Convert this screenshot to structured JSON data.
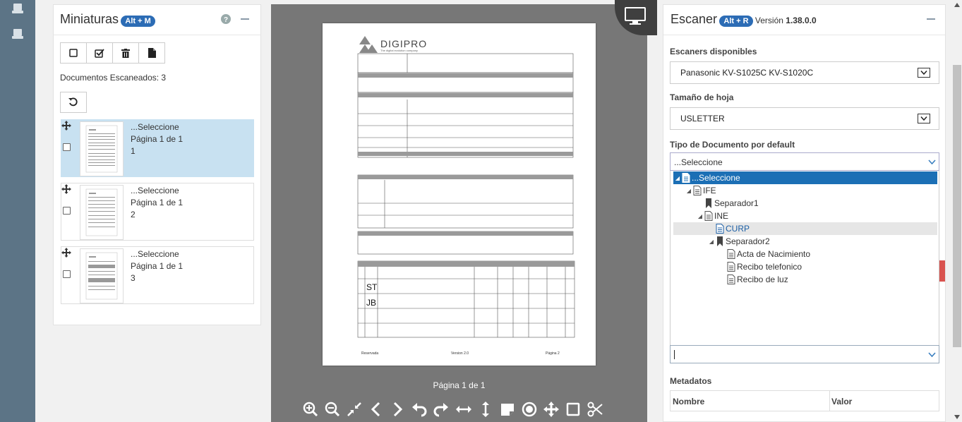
{
  "thumbnails": {
    "title": "Miniaturas",
    "shortcut": "Alt + M",
    "help_icon": "question-circle-icon",
    "collapse_icon": "minus-icon",
    "toolbar": [
      "square-icon",
      "check-square-icon",
      "trash-icon",
      "file-icon"
    ],
    "count_label": "Documentos Escaneados: 3",
    "refresh_icon": "undo-icon",
    "items": [
      {
        "type": "...Seleccione",
        "page": "Página 1 de 1",
        "number": "1",
        "selected": true
      },
      {
        "type": "...Seleccione",
        "page": "Página 1 de 1",
        "number": "2",
        "selected": false
      },
      {
        "type": "...Seleccione",
        "page": "Página 1 de 1",
        "number": "3",
        "selected": false
      }
    ]
  },
  "viewer": {
    "page_label": "Página 1 de 1",
    "monitor_icon": "monitor-icon",
    "tools": [
      "zoom-in-icon",
      "zoom-out-icon",
      "compress-icon",
      "chevron-left-icon",
      "chevron-right-icon",
      "rotate-left-icon",
      "rotate-right-icon",
      "flip-horizontal-icon",
      "flip-vertical-icon",
      "sticky-note-icon",
      "target-icon",
      "move-icon",
      "crop-square-icon",
      "scissors-icon"
    ],
    "document": {
      "logo": "DIGIPRO",
      "tagline": "The digital evolution company",
      "footer_left": "Reservada",
      "footer_center": "Version 2.0",
      "footer_right": "Página 2",
      "row_initials": [
        "ST",
        "JB"
      ]
    }
  },
  "scanner": {
    "title": "Escaner",
    "shortcut": "Alt + R",
    "version_prefix": "Versión",
    "version": "1.38.0.0",
    "collapse_icon": "minus-icon",
    "available_label": "Escaners disponibles",
    "available_value": "Panasonic KV-S1025C KV-S1020C",
    "size_label": "Tamaño de hoja",
    "size_value": "USLETTER",
    "doc_type_label": "Tipo de Documento por default",
    "doc_type_value": "...Seleccione",
    "tree": [
      {
        "label": "...Seleccione",
        "level": 0,
        "kind": "doc",
        "expanded": true,
        "selected": true
      },
      {
        "label": "IFE",
        "level": 1,
        "kind": "doc",
        "expanded": true
      },
      {
        "label": "Separador1",
        "level": 2,
        "kind": "bookmark"
      },
      {
        "label": "INE",
        "level": 2,
        "kind": "doc",
        "expanded": true
      },
      {
        "label": "CURP",
        "level": 3,
        "kind": "doc",
        "hover": true
      },
      {
        "label": "Separador2",
        "level": 3,
        "kind": "bookmark",
        "expanded": true
      },
      {
        "label": "Acta de Nacimiento",
        "level": 4,
        "kind": "doc"
      },
      {
        "label": "Recibo telefonico",
        "level": 4,
        "kind": "doc"
      },
      {
        "label": "Recibo de luz",
        "level": 4,
        "kind": "doc"
      }
    ],
    "metadata_label": "Metadatos",
    "meta_col_name": "Nombre",
    "meta_col_value": "Valor"
  }
}
